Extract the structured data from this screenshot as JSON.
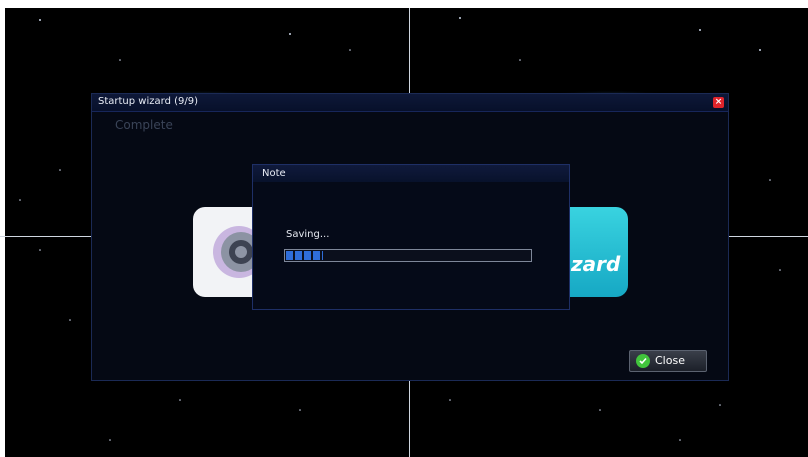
{
  "wizard": {
    "title": "Startup wizard (9/9)",
    "step_heading": "Complete",
    "close_button": "Close",
    "banner_text": "zard"
  },
  "note": {
    "title": "Note",
    "status": "Saving...",
    "progress": 0.15
  },
  "colors": {
    "accent": "#2f6dd8",
    "close_red": "#e0242b",
    "confirm_green": "#41c53c"
  }
}
